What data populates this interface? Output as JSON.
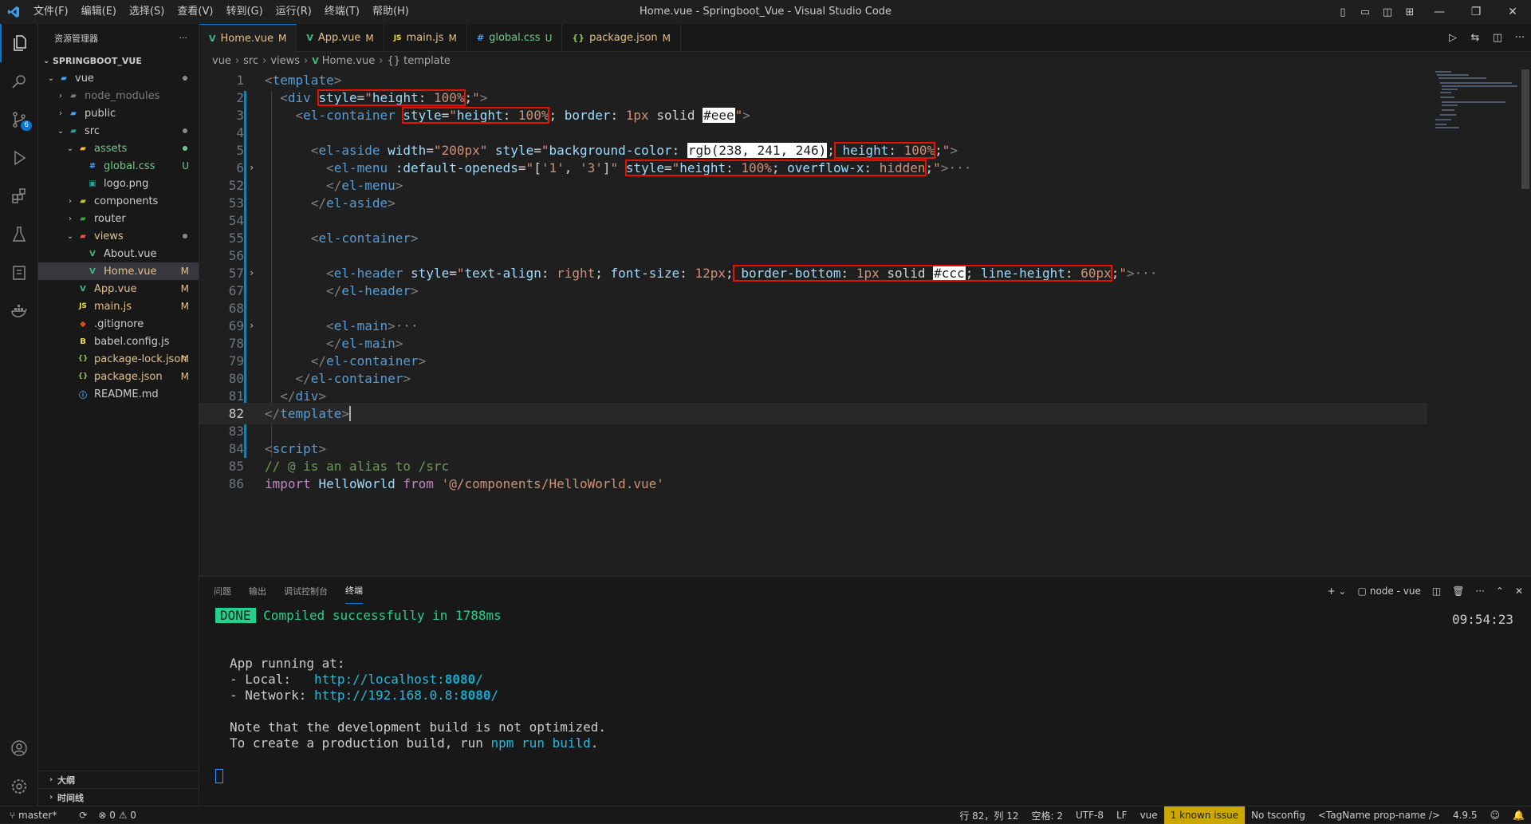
{
  "titlebar": {
    "menus": [
      "文件(F)",
      "编辑(E)",
      "选择(S)",
      "查看(V)",
      "转到(G)",
      "运行(R)",
      "终端(T)",
      "帮助(H)"
    ],
    "title": "Home.vue - Springboot_Vue - Visual Studio Code"
  },
  "activity": {
    "scm_badge": "6"
  },
  "sidebar": {
    "header": "资源管理器",
    "more": "···",
    "project": "SPRINGBOOT_VUE",
    "tree": [
      {
        "label": "vue",
        "git": ""
      },
      {
        "label": "node_modules",
        "git": ""
      },
      {
        "label": "public",
        "git": ""
      },
      {
        "label": "src",
        "git": ""
      },
      {
        "label": "assets",
        "git": ""
      },
      {
        "label": "global.css",
        "git": "U"
      },
      {
        "label": "logo.png",
        "git": ""
      },
      {
        "label": "components",
        "git": ""
      },
      {
        "label": "router",
        "git": ""
      },
      {
        "label": "views",
        "git": ""
      },
      {
        "label": "About.vue",
        "git": ""
      },
      {
        "label": "Home.vue",
        "git": "M"
      },
      {
        "label": "App.vue",
        "git": "M"
      },
      {
        "label": "main.js",
        "git": "M"
      },
      {
        "label": ".gitignore",
        "git": ""
      },
      {
        "label": "babel.config.js",
        "git": ""
      },
      {
        "label": "package-lock.json",
        "git": "M"
      },
      {
        "label": "package.json",
        "git": "M"
      },
      {
        "label": "README.md",
        "git": ""
      }
    ],
    "outline": "大纲",
    "timeline": "时间线"
  },
  "tabs": [
    {
      "icon": "V",
      "label": "Home.vue",
      "mark": "M"
    },
    {
      "icon": "V",
      "label": "App.vue",
      "mark": "M"
    },
    {
      "icon": "JS",
      "label": "main.js",
      "mark": "M"
    },
    {
      "icon": "#",
      "label": "global.css",
      "mark": "U"
    },
    {
      "icon": "{}",
      "label": "package.json",
      "mark": "M"
    }
  ],
  "breadcrumb": [
    "vue",
    "src",
    "views",
    "Home.vue",
    "{} template"
  ],
  "editor": {
    "line_numbers": [
      "1",
      "2",
      "3",
      "4",
      "5",
      "6",
      "52",
      "53",
      "54",
      "55",
      "56",
      "57",
      "67",
      "68",
      "69",
      "78",
      "79",
      "80",
      "81",
      "82",
      "83",
      "84",
      "85",
      "86"
    ]
  },
  "panel": {
    "tabs": [
      "问题",
      "输出",
      "调试控制台",
      "终端"
    ],
    "terminal_name": "node - vue",
    "done_label": "DONE",
    "compiled": "Compiled successfully in 1788ms",
    "time": "09:54:23",
    "app_running": "App running at:",
    "local_label": "- Local:   ",
    "local_url_pre": "http://localhost:",
    "local_port": "8080",
    "network_label": "- Network: ",
    "network_url_pre": "http://192.168.0.8:",
    "network_port": "8080",
    "note1": "Note that the development build is not optimized.",
    "note2_pre": "To create a production build, run ",
    "note2_cmd": "npm run build",
    "note2_post": "."
  },
  "status": {
    "branch": "master*",
    "errors": "⊗ 0 ⚠ 0",
    "position": "行 82，列 12",
    "spaces": "空格: 2",
    "encoding": "UTF-8",
    "eol": "LF",
    "lang": "vue",
    "issue": "1 known issue",
    "tsconfig": "No tsconfig",
    "tagname": "<TagName prop-name />",
    "version": "4.9.5"
  },
  "colors": {
    "accent": "#0078d4",
    "highlight_box": "#e51400",
    "git_modified": "#e2c08d",
    "git_untracked": "#73c991"
  }
}
